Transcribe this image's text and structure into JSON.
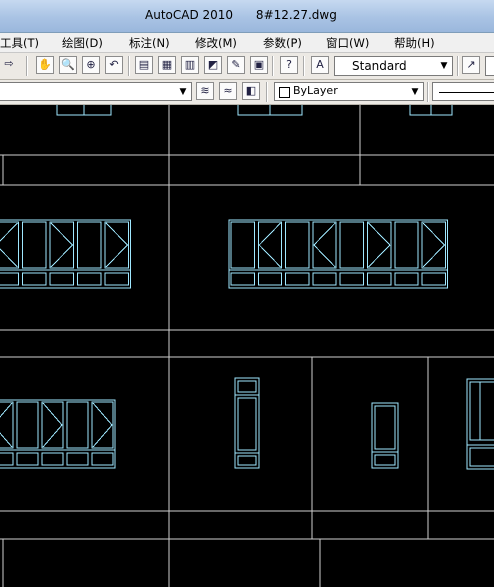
{
  "app": {
    "title": "AutoCAD 2010      8#12.27.dwg"
  },
  "menu": {
    "items": [
      "工具(T)",
      "绘图(D)",
      "标注(N)",
      "修改(M)",
      "参数(P)",
      "窗口(W)",
      "帮助(H)"
    ]
  },
  "toolbar": {
    "text_style": "Standard",
    "layer_combo": "",
    "color_combo": "ByLayer",
    "help_glyph": "?"
  },
  "colors": {
    "window_lines": "#9fe8ff",
    "grid_lines": "#cfcfcf",
    "background": "#000000"
  },
  "icons": [
    "nav-arrow-icon",
    "pan-icon",
    "zoom-realtime-icon",
    "zoom-window-icon",
    "zoom-previous-icon",
    "properties-icon",
    "design-center-icon",
    "tool-palettes-icon",
    "sheet-set-icon",
    "markup-icon",
    "calculator-icon",
    "help-icon",
    "text-style-icon",
    "dim-style-icon",
    "layer-manager-icon",
    "layer-state-icon",
    "layer-previous-icon"
  ]
}
